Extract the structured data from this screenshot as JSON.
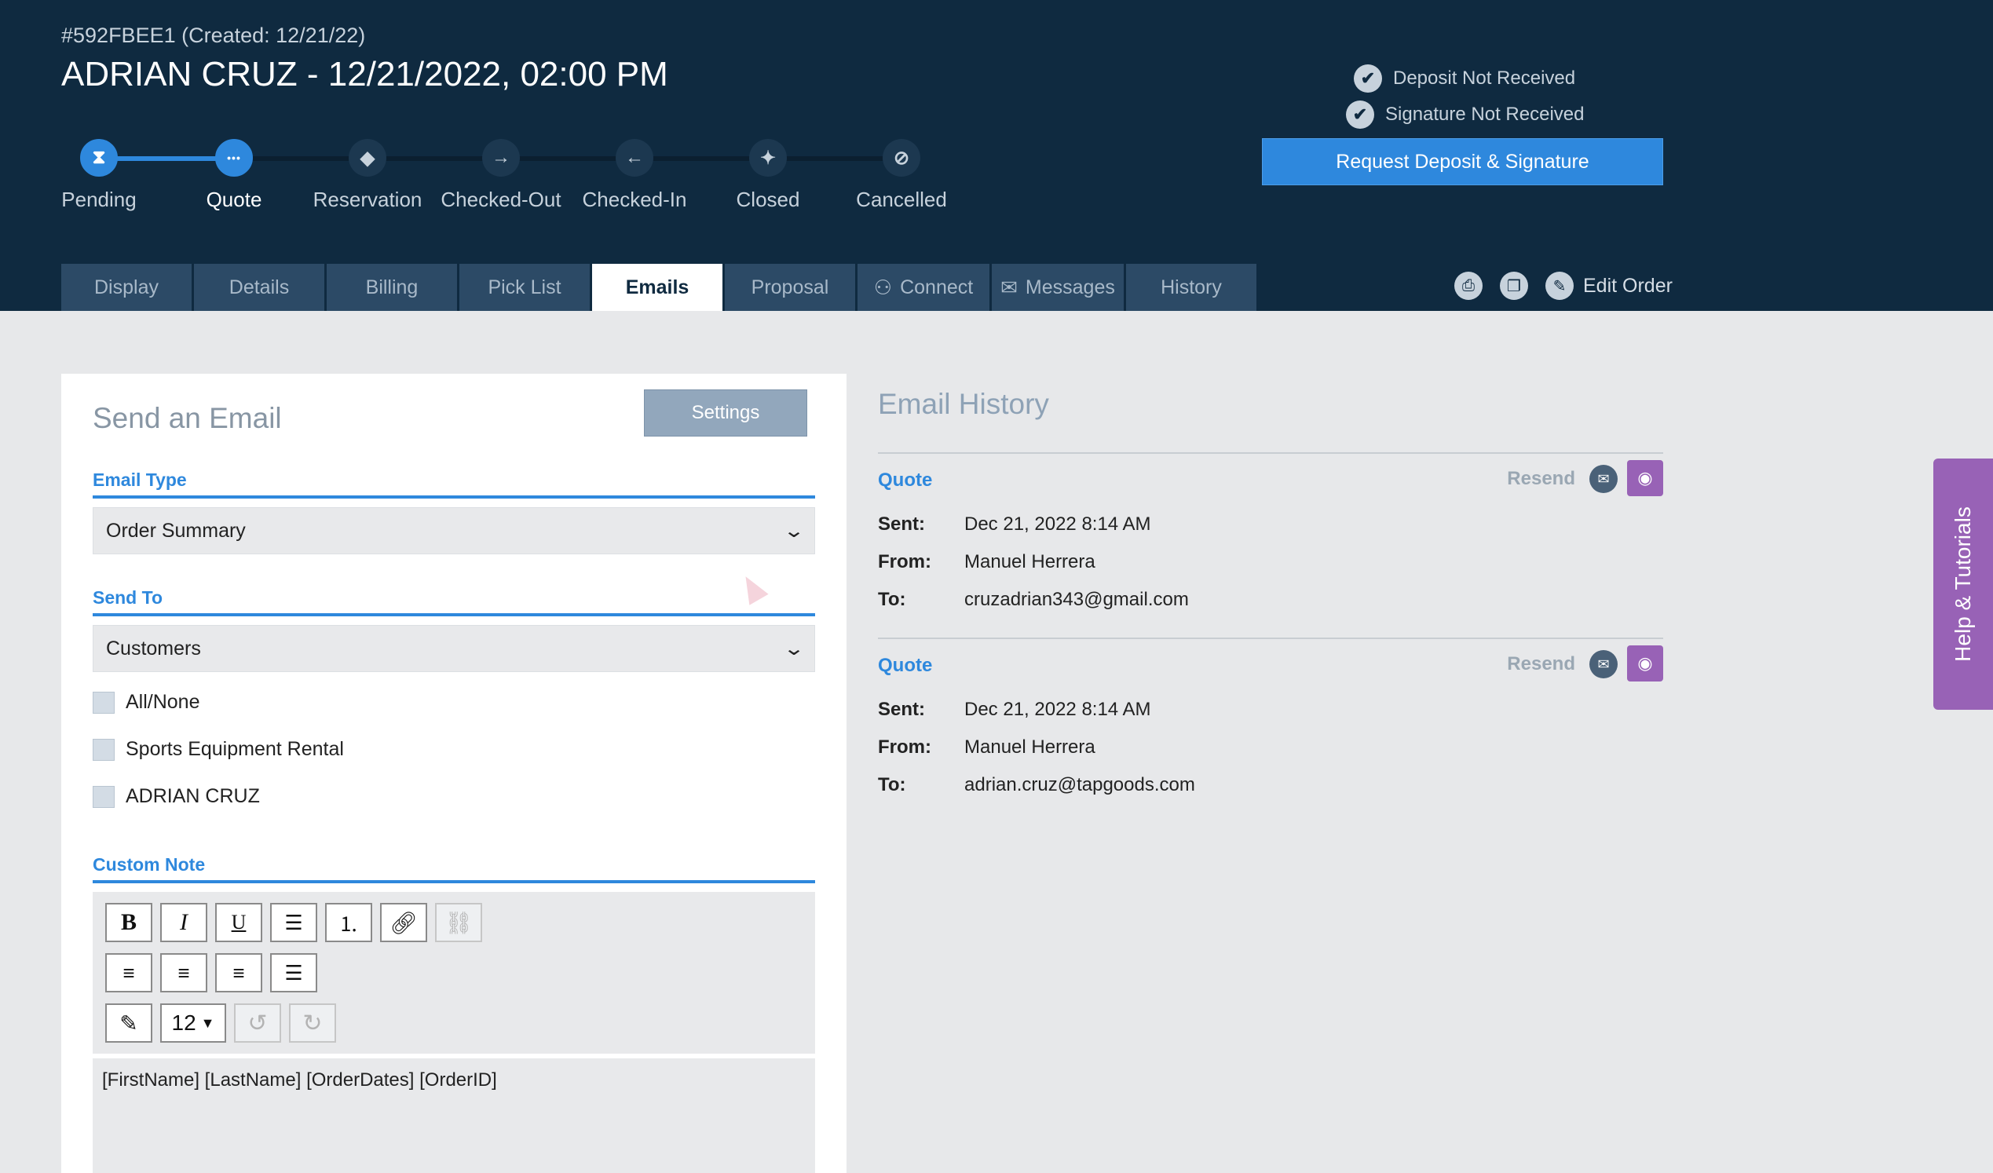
{
  "order": {
    "id_line": "#592FBEE1 (Created: 12/21/22)",
    "title": "ADRIAN CRUZ - 12/21/2022, 02:00 PM"
  },
  "steps": [
    {
      "label": "Pending",
      "icon": "hourglass-icon",
      "glyph": "⧗",
      "state": "done"
    },
    {
      "label": "Quote",
      "icon": "ellipsis-icon",
      "glyph": "•••",
      "state": "current"
    },
    {
      "label": "Reservation",
      "icon": "tag-icon",
      "glyph": "◆",
      "state": "todo"
    },
    {
      "label": "Checked-Out",
      "icon": "arrow-right-icon",
      "glyph": "→",
      "state": "todo"
    },
    {
      "label": "Checked-In",
      "icon": "arrow-left-icon",
      "glyph": "←",
      "state": "todo"
    },
    {
      "label": "Closed",
      "icon": "closed-tag-icon",
      "glyph": "✦",
      "state": "todo"
    },
    {
      "label": "Cancelled",
      "icon": "cancel-icon",
      "glyph": "⊘",
      "state": "todo"
    }
  ],
  "status": {
    "deposit": "Deposit Not Received",
    "signature": "Signature Not Received",
    "request_button": "Request Deposit & Signature"
  },
  "tabs": [
    {
      "label": "Display",
      "icon": ""
    },
    {
      "label": "Details",
      "icon": ""
    },
    {
      "label": "Billing",
      "icon": ""
    },
    {
      "label": "Pick List",
      "icon": ""
    },
    {
      "label": "Emails",
      "icon": ""
    },
    {
      "label": "Proposal",
      "icon": ""
    },
    {
      "label": "Connect",
      "icon": "network-icon"
    },
    {
      "label": "Messages",
      "icon": "inbox-icon"
    },
    {
      "label": "History",
      "icon": ""
    }
  ],
  "active_tab": "Emails",
  "tools": {
    "edit_order": "Edit Order"
  },
  "send_email": {
    "title": "Send an Email",
    "settings_button": "Settings",
    "email_type_label": "Email Type",
    "email_type_value": "Order Summary",
    "send_to_label": "Send To",
    "send_to_value": "Customers",
    "recipients": [
      "All/None",
      "Sports Equipment Rental",
      "ADRIAN CRUZ"
    ],
    "custom_note_label": "Custom Note",
    "font_size": "12",
    "body_text": "[FirstName]  [LastName] [OrderDates] [OrderID]"
  },
  "email_history": {
    "title": "Email History",
    "resend_label": "Resend",
    "entries": [
      {
        "type": "Quote",
        "sent": "Dec 21, 2022  8:14 AM",
        "from": "Manuel Herrera",
        "to": "cruzadrian343@gmail.com"
      },
      {
        "type": "Quote",
        "sent": "Dec 21, 2022  8:14 AM",
        "from": "Manuel Herrera",
        "to": "adrian.cruz@tapgoods.com"
      }
    ],
    "labels": {
      "sent": "Sent:",
      "from": "From:",
      "to": "To:"
    }
  },
  "help": {
    "label": "Help & Tutorials"
  },
  "colors": {
    "header_bg": "#0f2a40",
    "accent_blue": "#2e88dd",
    "purple": "#9862b6",
    "tab_bg": "#2c4a66"
  }
}
